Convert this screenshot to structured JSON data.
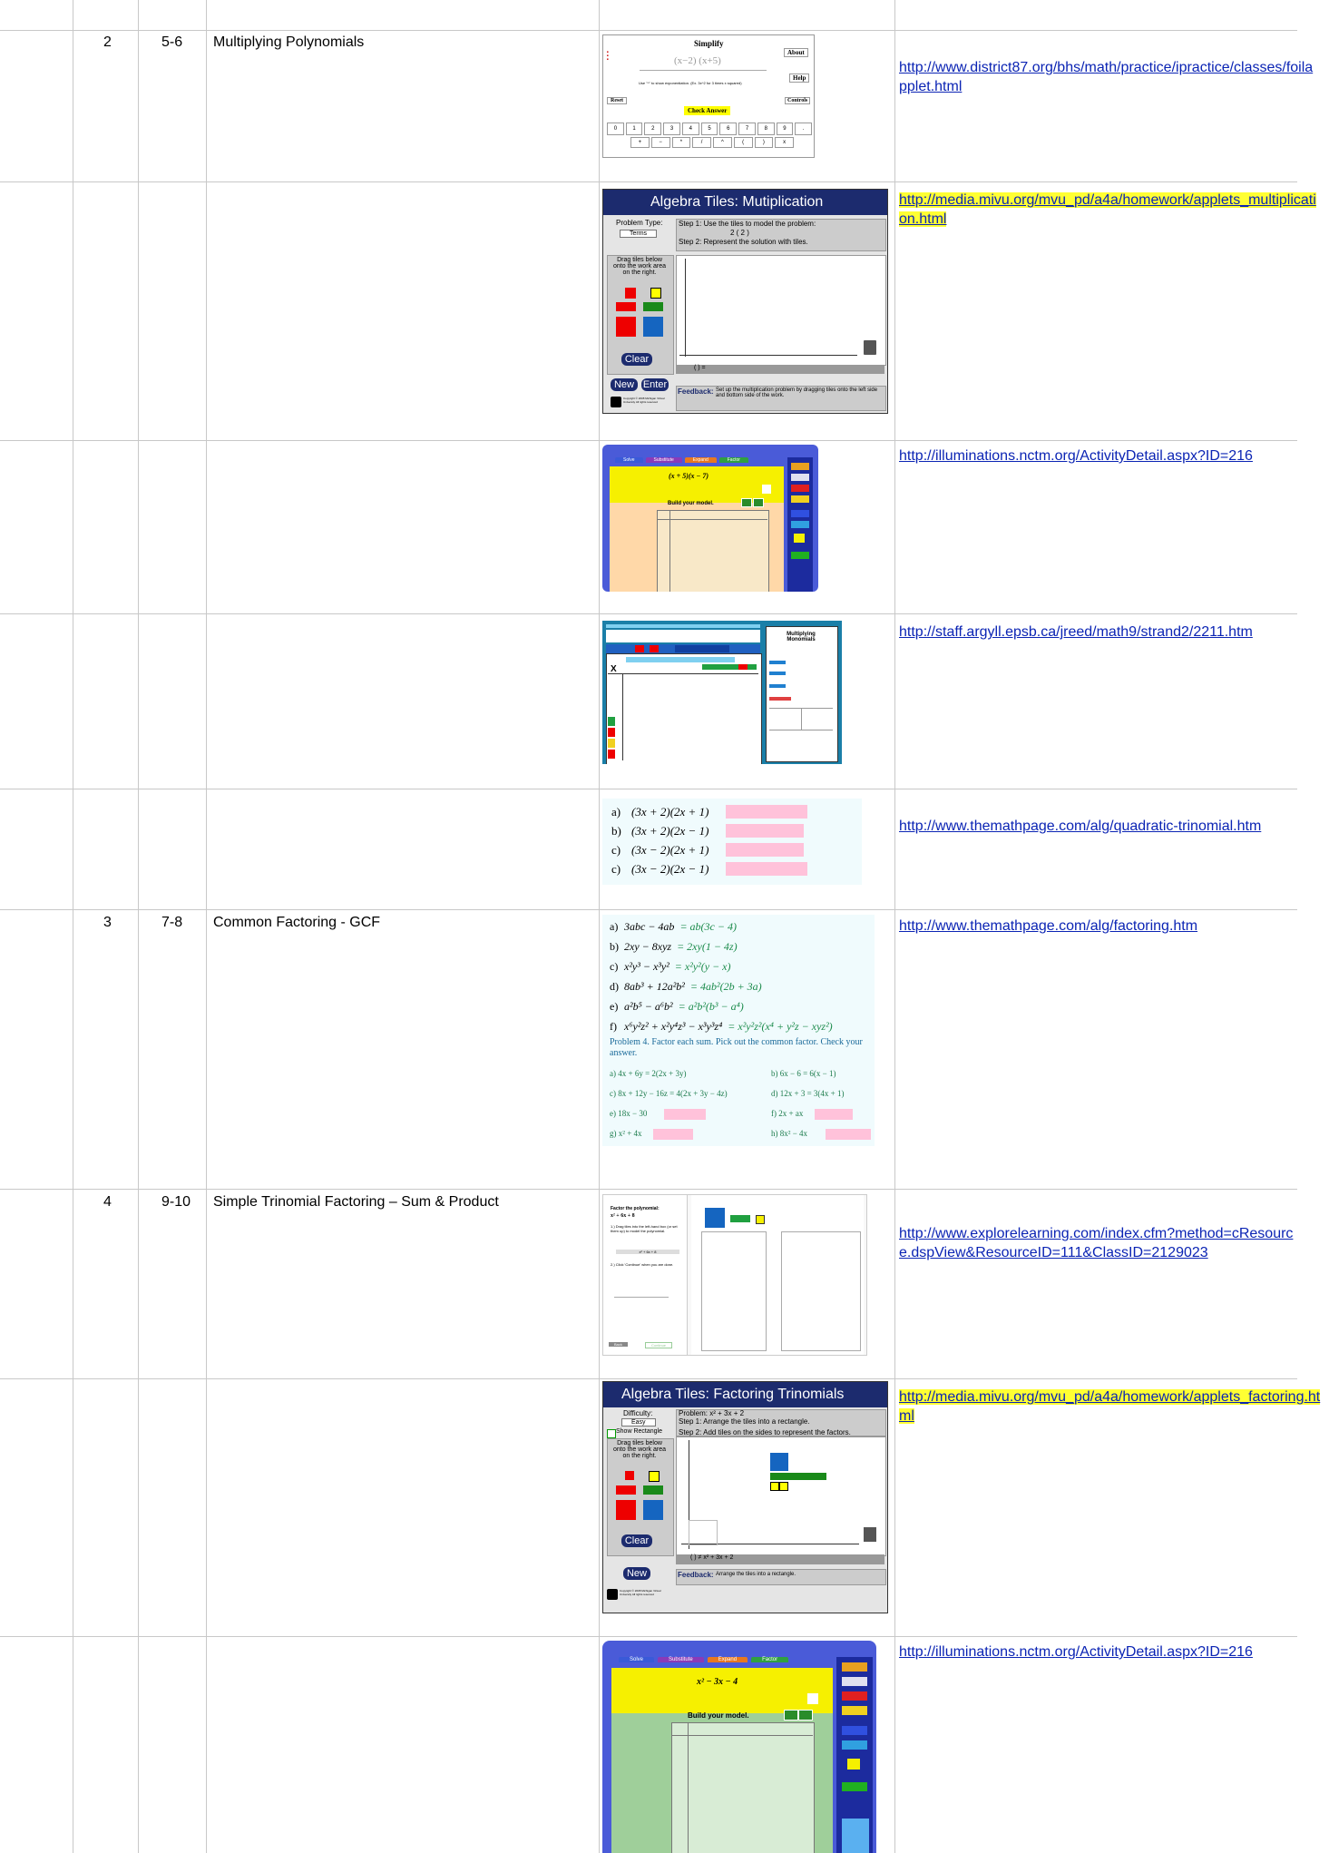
{
  "rows": [
    {
      "num": "2",
      "pages": "5-6",
      "topic": "Multiplying Polynomials",
      "link": "http://www.district87.org/bhs/math/practice/ipractice/classes/foilapplet.html",
      "highlight": false
    },
    {
      "num": "",
      "pages": "",
      "topic": "",
      "link": "http://media.mivu.org/mvu_pd/a4a/homework/applets_multiplication.html",
      "highlight": true
    },
    {
      "num": "",
      "pages": "",
      "topic": "",
      "link": "http://illuminations.nctm.org/ActivityDetail.aspx?ID=216",
      "highlight": false
    },
    {
      "num": "",
      "pages": "",
      "topic": "",
      "link": "http://staff.argyll.epsb.ca/jreed/math9/strand2/2211.htm",
      "highlight": false
    },
    {
      "num": "",
      "pages": "",
      "topic": "",
      "link": "http://www.themathpage.com/alg/quadratic-trinomial.htm",
      "highlight": false
    },
    {
      "num": "3",
      "pages": "7-8",
      "topic": "Common Factoring - GCF",
      "link": "http://www.themathpage.com/alg/factoring.htm",
      "highlight": false
    },
    {
      "num": "4",
      "pages": "9-10",
      "topic": "Simple Trinomial Factoring – Sum & Product",
      "link": "http://www.explorelearning.com/index.cfm?method=cResource.dspView&ResourceID=111&ClassID=2129023",
      "highlight": false
    },
    {
      "num": "",
      "pages": "",
      "topic": "",
      "link": "http://media.mivu.org/mvu_pd/a4a/homework/applets_factoring.html",
      "highlight": true
    },
    {
      "num": "",
      "pages": "",
      "topic": "",
      "link": "http://illuminations.nctm.org/ActivityDetail.aspx?ID=216",
      "highlight": false
    }
  ],
  "foil": {
    "title": "Simplify",
    "expr": "(x−2) (x+5)",
    "about": "About",
    "help": "Help",
    "controls": "Controls",
    "reset": "Reset",
    "check": "Check Answer",
    "hint": "Use \"^\" to show exponentiation. (Ex. 3x^2 for 3 times x squared)",
    "keys": [
      "0",
      "1",
      "2",
      "3",
      "4",
      "5",
      "6",
      "7",
      "8",
      "9",
      "."
    ],
    "ops": [
      "+",
      "−",
      "*",
      "/",
      "^",
      "(",
      ")",
      "x"
    ]
  },
  "tiles_mult": {
    "title": "Algebra Tiles: Mutiplication",
    "problem_type": "Problem Type:",
    "select": "Terms",
    "step1": "Step 1: Use the tiles to model the problem:",
    "prob": "2 ( 2 )",
    "step2": "Step 2: Represent the solution with tiles.",
    "drag": "Drag tiles below onto the work area on the right.",
    "clear": "Clear",
    "new": "New",
    "enter": "Enter",
    "result": "(  )  =",
    "feedback_label": "Feedback:",
    "feedback": "Set up the multiplication problem by dragging tiles onto the left side and bottom side of the work.",
    "copyright": "Copyright © 2008 Michigan Virtual University All rights reserved"
  },
  "illum1": {
    "tabs": [
      "Solve",
      "Substitute",
      "Expand",
      "Factor"
    ],
    "expr": "(x + 5)(x − 7)",
    "build": "Build your model."
  },
  "argyll": {
    "header": "Multiplying Monomials",
    "x_label": "X"
  },
  "mathpage1": {
    "items": [
      {
        "label": "a)",
        "expr": "(3x + 2)(2x + 1)"
      },
      {
        "label": "b)",
        "expr": "(3x + 2)(2x − 1)"
      },
      {
        "label": "c)",
        "expr": "(3x − 2)(2x + 1)"
      },
      {
        "label": "c)",
        "expr": "(3x − 2)(2x − 1)"
      }
    ]
  },
  "mathpage2": {
    "lines": [
      {
        "label": "a)",
        "expr": "3abc − 4ab",
        "ans": "= ab(3c − 4)"
      },
      {
        "label": "b)",
        "expr": "2xy − 8xyz",
        "ans": "= 2xy(1 − 4z)"
      },
      {
        "label": "c)",
        "expr": "x²y³ − x³y²",
        "ans": "= x²y²(y − x)"
      },
      {
        "label": "d)",
        "expr": "8ab³ + 12a²b²",
        "ans": "= 4ab²(2b + 3a)"
      },
      {
        "label": "e)",
        "expr": "a²b⁵ − a⁶b²",
        "ans": "= a²b²(b³ − a⁴)"
      },
      {
        "label": "f)",
        "expr": "x⁶y²z² + x²y⁴z³ − x³y³z⁴",
        "ans": "= x²y²z²(x⁴ + y²z − xyz²)"
      }
    ],
    "problem": "Problem 4.  Factor each sum. Pick out the common factor. Check your answer.",
    "pairs": [
      {
        "l": "a)  4x + 6y = 2(2x + 3y)",
        "r": "b)  6x − 6 = 6(x − 1)",
        "lp": false,
        "rp": false
      },
      {
        "l": "c)  8x + 12y − 16z = 4(2x + 3y − 4z)",
        "r": "d)  12x + 3 = 3(4x + 1)",
        "lp": false,
        "rp": false
      },
      {
        "l": "e)  18x − 30",
        "r": "f)  2x + ax",
        "lp": true,
        "rp": true
      },
      {
        "l": "g)  x² + 4x",
        "r": "h)  8x² − 4x",
        "lp": true,
        "rp": true
      }
    ]
  },
  "explore": {
    "title": "Factor the polynomial:",
    "poly": "x² + 6x + 8",
    "step1": "1.) Drag tiles into the left-hand box (or set them up) to model the polynomial.",
    "box": "x² + 6x + 8",
    "step2": "2.) Click 'Continue' when you are done.",
    "btn1": "Back",
    "btn2": "Continue"
  },
  "tiles_fact": {
    "title": "Algebra Tiles: Factoring Trinomials",
    "difficulty": "Difficulty:",
    "select": "Easy",
    "show_rect": "Show Rectangle",
    "problem": "Problem:  x² + 3x + 2",
    "step1": "Step 1: Arrange the tiles into a rectangle.",
    "step2": "Step 2: Add tiles on the sides to represent the factors.",
    "drag": "Drag tiles below onto the work area on the right.",
    "clear": "Clear",
    "new": "New",
    "result": "(  )  ≠  x² + 3x + 2",
    "feedback_label": "Feedback:",
    "feedback": "Arrange the tiles into a rectangle.",
    "copyright": "Copyright © 2008 Michigan Virtual University All rights reserved"
  },
  "illum2": {
    "tabs": [
      "Solve",
      "Substitute",
      "Expand",
      "Factor"
    ],
    "expr": "x² − 3x − 4",
    "build": "Build your model."
  },
  "colors": {
    "grid": "#c8c8c8",
    "link": "#0b24b4",
    "highlight": "#ffff33",
    "pink": "#ffc2da",
    "navy": "#1c2b6e"
  }
}
